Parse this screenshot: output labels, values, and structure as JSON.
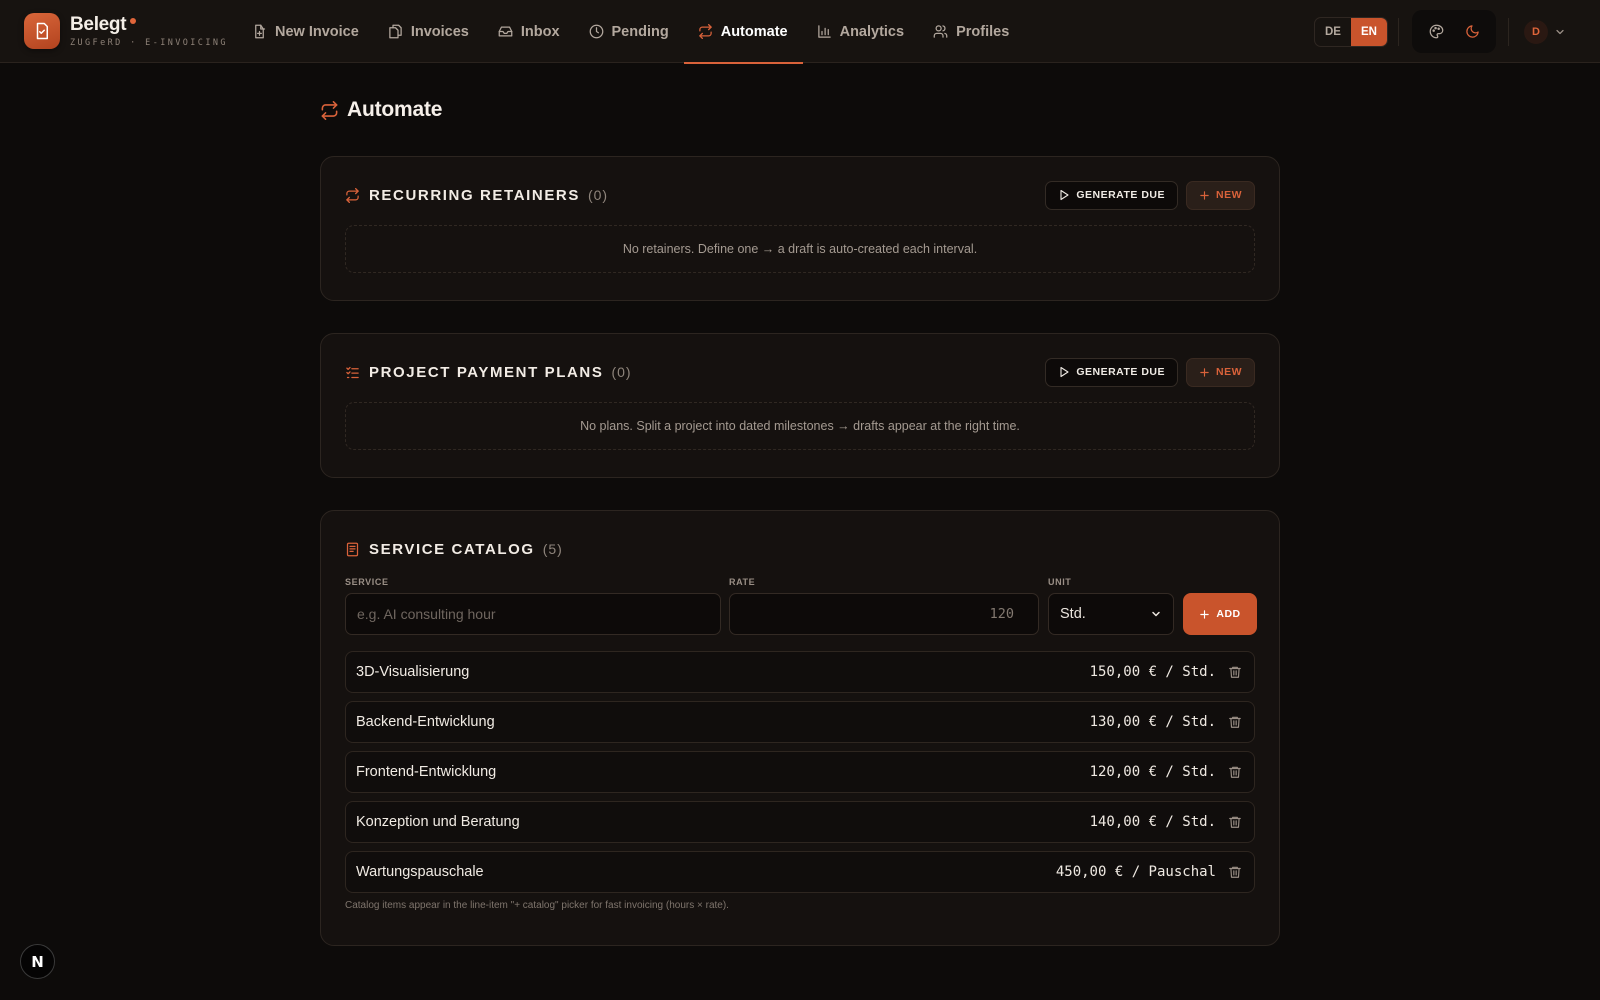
{
  "brand": {
    "name": "Belegt",
    "subtitle": "ZUGFeRD · E-INVOICING"
  },
  "nav": [
    {
      "label": "New Invoice",
      "icon": "file-plus-icon",
      "active": false
    },
    {
      "label": "Invoices",
      "icon": "files-icon",
      "active": false
    },
    {
      "label": "Inbox",
      "icon": "inbox-icon",
      "active": false
    },
    {
      "label": "Pending",
      "icon": "clock-icon",
      "active": false
    },
    {
      "label": "Automate",
      "icon": "repeat-icon",
      "active": true
    },
    {
      "label": "Analytics",
      "icon": "bar-chart-icon",
      "active": false
    },
    {
      "label": "Profiles",
      "icon": "users-icon",
      "active": false
    }
  ],
  "lang": {
    "de": "DE",
    "en": "EN",
    "selected": "EN"
  },
  "user": {
    "initial": "D"
  },
  "page": {
    "title": "Automate"
  },
  "retainers": {
    "title": "RECURRING RETAINERS",
    "count": "(0)",
    "generate_label": "GENERATE DUE",
    "new_label": "NEW",
    "empty_text": "No retainers. Define one → a draft is auto-created each interval."
  },
  "plans": {
    "title": "PROJECT PAYMENT PLANS",
    "count": "(0)",
    "generate_label": "GENERATE DUE",
    "new_label": "NEW",
    "empty_text": "No plans. Split a project into dated milestones → drafts appear at the right time."
  },
  "catalog": {
    "title": "SERVICE CATALOG",
    "count": "(5)",
    "form": {
      "service_label": "SERVICE",
      "service_placeholder": "e.g. AI consulting hour",
      "rate_label": "RATE",
      "rate_placeholder": "120",
      "unit_label": "UNIT",
      "unit_value": "Std.",
      "add_label": "ADD"
    },
    "items": [
      {
        "name": "3D-Visualisierung",
        "price": "150,00 € / Std."
      },
      {
        "name": "Backend-Entwicklung",
        "price": "130,00 € / Std."
      },
      {
        "name": "Frontend-Entwicklung",
        "price": "120,00 € / Std."
      },
      {
        "name": "Konzeption und Beratung",
        "price": "140,00 € / Std."
      },
      {
        "name": "Wartungspauschale",
        "price": "450,00 € / Pauschal"
      }
    ],
    "footnote": "Catalog items appear in the line-item \"+ catalog\" picker for fast invoicing (hours × rate)."
  },
  "fab": {
    "label": "N"
  },
  "colors": {
    "accent": "#d9623a",
    "background": "#0d0b0a",
    "card": "#15110f"
  }
}
